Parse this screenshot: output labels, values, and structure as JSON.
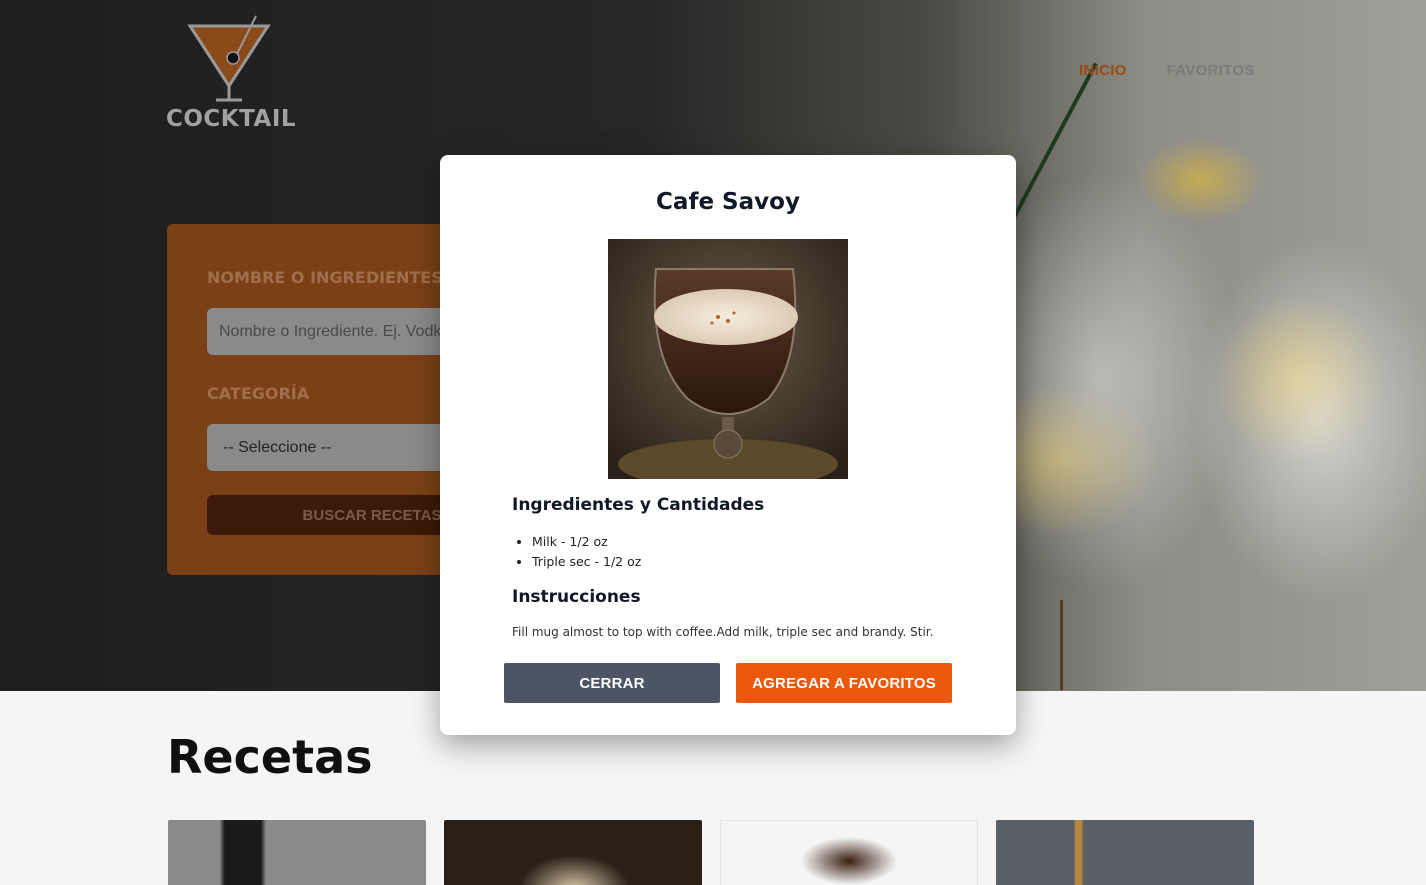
{
  "brand": {
    "logo_text": "COCKTAIL"
  },
  "nav": {
    "items": [
      {
        "label": "INICIO",
        "active": true
      },
      {
        "label": "FAVORITOS",
        "active": false
      }
    ]
  },
  "search_form": {
    "name_label": "NOMBRE O INGREDIENTES",
    "name_placeholder": "Nombre o Ingrediente. Ej. Vodka, Tequila, etc",
    "category_label": "CATEGORÍA",
    "category_selected": "-- Seleccione --",
    "submit_label": "BUSCAR RECETAS"
  },
  "recipes_section": {
    "title": "Recetas"
  },
  "modal": {
    "title": "Cafe Savoy",
    "ingredients_title": "Ingredientes y Cantidades",
    "ingredients": [
      "Milk - 1/2 oz",
      "Triple sec - 1/2 oz"
    ],
    "instructions_title": "Instrucciones",
    "instructions": "Fill mug almost to top with coffee.Add milk, triple sec and brandy. Stir.",
    "close_label": "CERRAR",
    "favorite_label": "AGREGAR A FAVORITOS"
  },
  "colors": {
    "accent": "#ea580c",
    "close_button": "#4b5563",
    "search_card": "#7a4117",
    "nav_active": "#9a4a10"
  },
  "icons": {
    "logo": "martini-glass-icon",
    "bullet": "disc"
  }
}
